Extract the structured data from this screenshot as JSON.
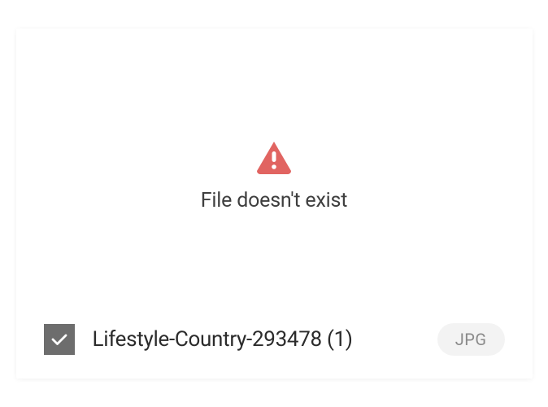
{
  "preview": {
    "error_message": "File doesn't exist"
  },
  "file": {
    "name": "Lifestyle-Country-293478 (1)",
    "type_badge": "JPG",
    "selected": true
  },
  "colors": {
    "warning": "#e16461",
    "checkbox_bg": "#6d6d6d",
    "badge_bg": "#f3f3f3",
    "badge_text": "#8a8a8a"
  }
}
